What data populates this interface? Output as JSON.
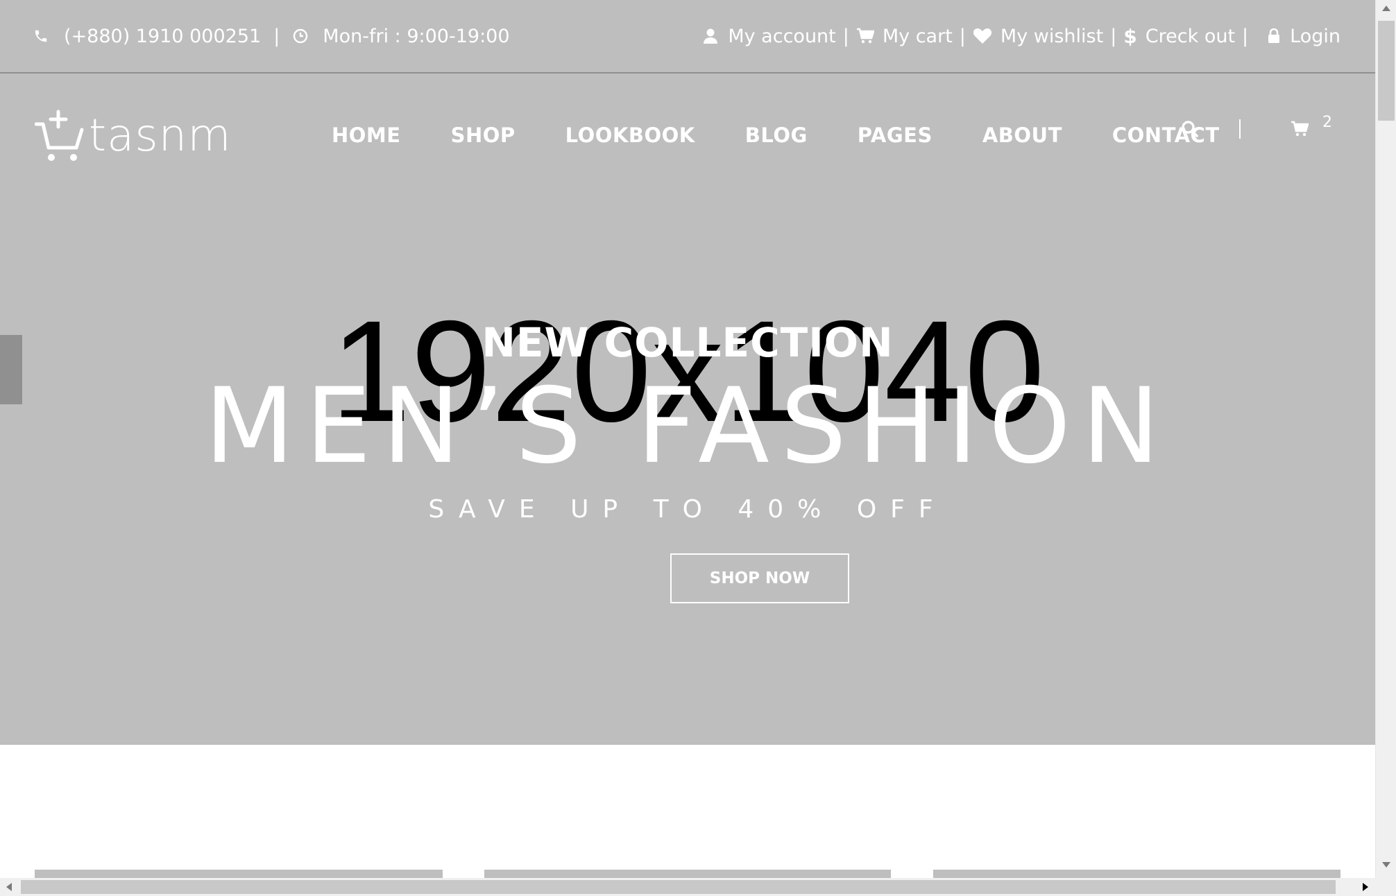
{
  "topbar": {
    "phone": "(+880) 1910 000251",
    "hours": "Mon-fri : 9:00-19:00",
    "links": [
      {
        "label": "My account",
        "icon": "user-icon"
      },
      {
        "label": "My cart",
        "icon": "cart-icon"
      },
      {
        "label": "My wishlist",
        "icon": "heart-icon"
      },
      {
        "label": "Creck out",
        "icon": "dollar-icon"
      },
      {
        "label": "Login",
        "icon": "lock-icon"
      }
    ],
    "separator": "|"
  },
  "header": {
    "logo_text": "tasnm",
    "nav": [
      "HOME",
      "SHOP",
      "LOOKBOOK",
      "BLOG",
      "PAGES",
      "ABOUT",
      "CONTACT"
    ],
    "cart_count": "2"
  },
  "hero": {
    "placeholder": "1920x1040",
    "eyebrow": "NEW COLLECTION",
    "headline": "MEN’S FASHION",
    "subline": "SAVE UP TO 40% OFF",
    "cta": "SHOP NOW"
  },
  "colors": {
    "hero_bg": "#bebebe",
    "text": "#ffffff",
    "page_bg": "#ffffff"
  }
}
